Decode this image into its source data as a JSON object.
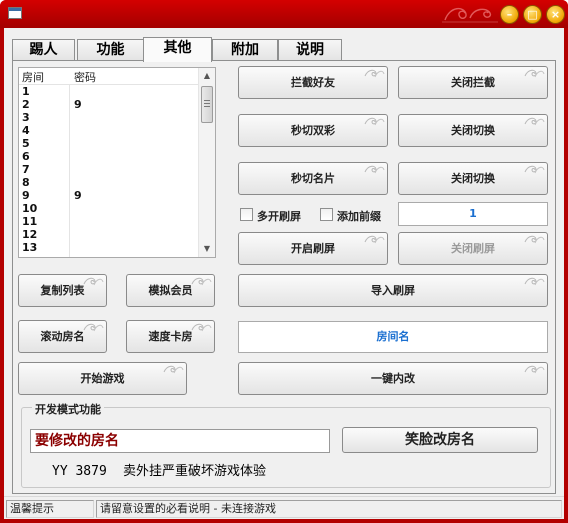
{
  "window": {
    "title": "",
    "colors": {
      "frame": "#b30000",
      "accent_blue": "#1a6fd0",
      "room_name_red": "#8b0000"
    }
  },
  "tabs": [
    {
      "label": "踢人",
      "active": false
    },
    {
      "label": "功能",
      "active": false
    },
    {
      "label": "其他",
      "active": true
    },
    {
      "label": "附加",
      "active": false
    },
    {
      "label": "说明",
      "active": false
    }
  ],
  "room_list": {
    "headers": [
      "房间",
      "密码"
    ],
    "rows": [
      {
        "room": "1",
        "password": ""
      },
      {
        "room": "2",
        "password": "9"
      },
      {
        "room": "3",
        "password": ""
      },
      {
        "room": "4",
        "password": ""
      },
      {
        "room": "5",
        "password": ""
      },
      {
        "room": "6",
        "password": ""
      },
      {
        "room": "7",
        "password": ""
      },
      {
        "room": "8",
        "password": ""
      },
      {
        "room": "9",
        "password": "9"
      },
      {
        "room": "10",
        "password": ""
      },
      {
        "room": "11",
        "password": ""
      },
      {
        "room": "12",
        "password": ""
      },
      {
        "room": "13",
        "password": ""
      }
    ]
  },
  "buttons": {
    "block_friends": "拦截好友",
    "close_block": "关闭拦截",
    "instant_color": "秒切双彩",
    "close_switch_1": "关闭切换",
    "instant_card": "秒切名片",
    "close_switch_2": "关闭切换",
    "start_spam": "开启刷屏",
    "close_spam": "关闭刷屏",
    "copy_list": "复制列表",
    "simulate_member": "模拟会员",
    "import_spam": "导入刷屏",
    "scroll_room_name": "滚动房名",
    "speed_card_room": "速度卡房",
    "start_game": "开始游戏",
    "one_key_rename": "一键内改"
  },
  "checkboxes": {
    "multi_spam": {
      "label": "多开刷屏",
      "checked": false
    },
    "add_prefix": {
      "label": "添加前缀",
      "checked": false
    }
  },
  "spam_count": "1",
  "room_name_field": "房间名",
  "dev_mode": {
    "title": "开发模式功能",
    "rename_input": "要修改的房名",
    "rename_button": "笑脸改房名",
    "info_prefix": "YY 3879",
    "info_text": "卖外挂严重破坏游戏体验"
  },
  "status": {
    "left": "温馨提示",
    "right": "请留意设置的必看说明 - 未连接游戏"
  }
}
